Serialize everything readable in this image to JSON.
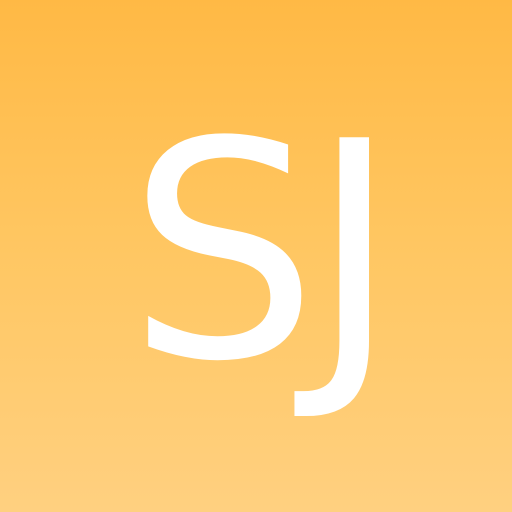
{
  "avatar": {
    "initials": "SJ",
    "background_top_color": "#FFB945",
    "background_bottom_color": "#FFD080",
    "text_color": "#FFFFFF"
  }
}
